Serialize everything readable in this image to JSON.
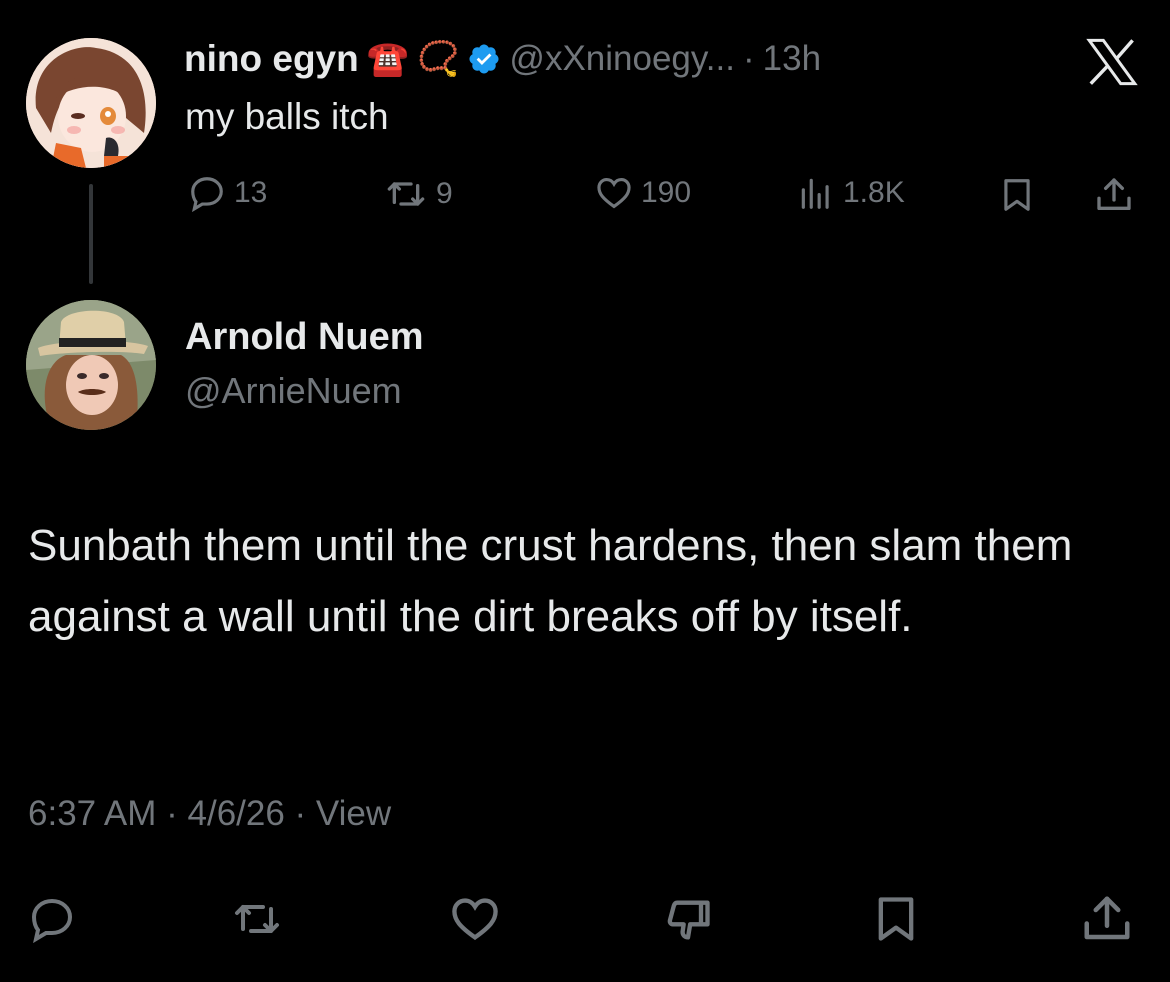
{
  "parent_tweet": {
    "display_name": "nino egyn",
    "name_emojis": [
      "☎️",
      "📿"
    ],
    "handle": "@xXninoegy...",
    "separator": "·",
    "time": "13h",
    "text": "my balls itch",
    "stats": {
      "replies": "13",
      "retweets": "9",
      "likes": "190",
      "views": "1.8K"
    }
  },
  "reply_tweet": {
    "display_name": "Arnold Nuem",
    "handle": "@ArnieNuem",
    "text": "Sunbath them until the crust hardens, then slam them against a wall until the dirt breaks off by itself.",
    "timestamp": "6:37 AM · 4/6/26 · View"
  },
  "colors": {
    "background": "#000000",
    "text": "#e7e9ea",
    "muted": "#71767b",
    "verified": "#1d9bf0"
  },
  "icons": [
    "x-logo-icon",
    "verified-badge-icon",
    "reply-icon",
    "retweet-icon",
    "like-icon",
    "views-icon",
    "bookmark-icon",
    "share-icon",
    "dislike-icon"
  ]
}
